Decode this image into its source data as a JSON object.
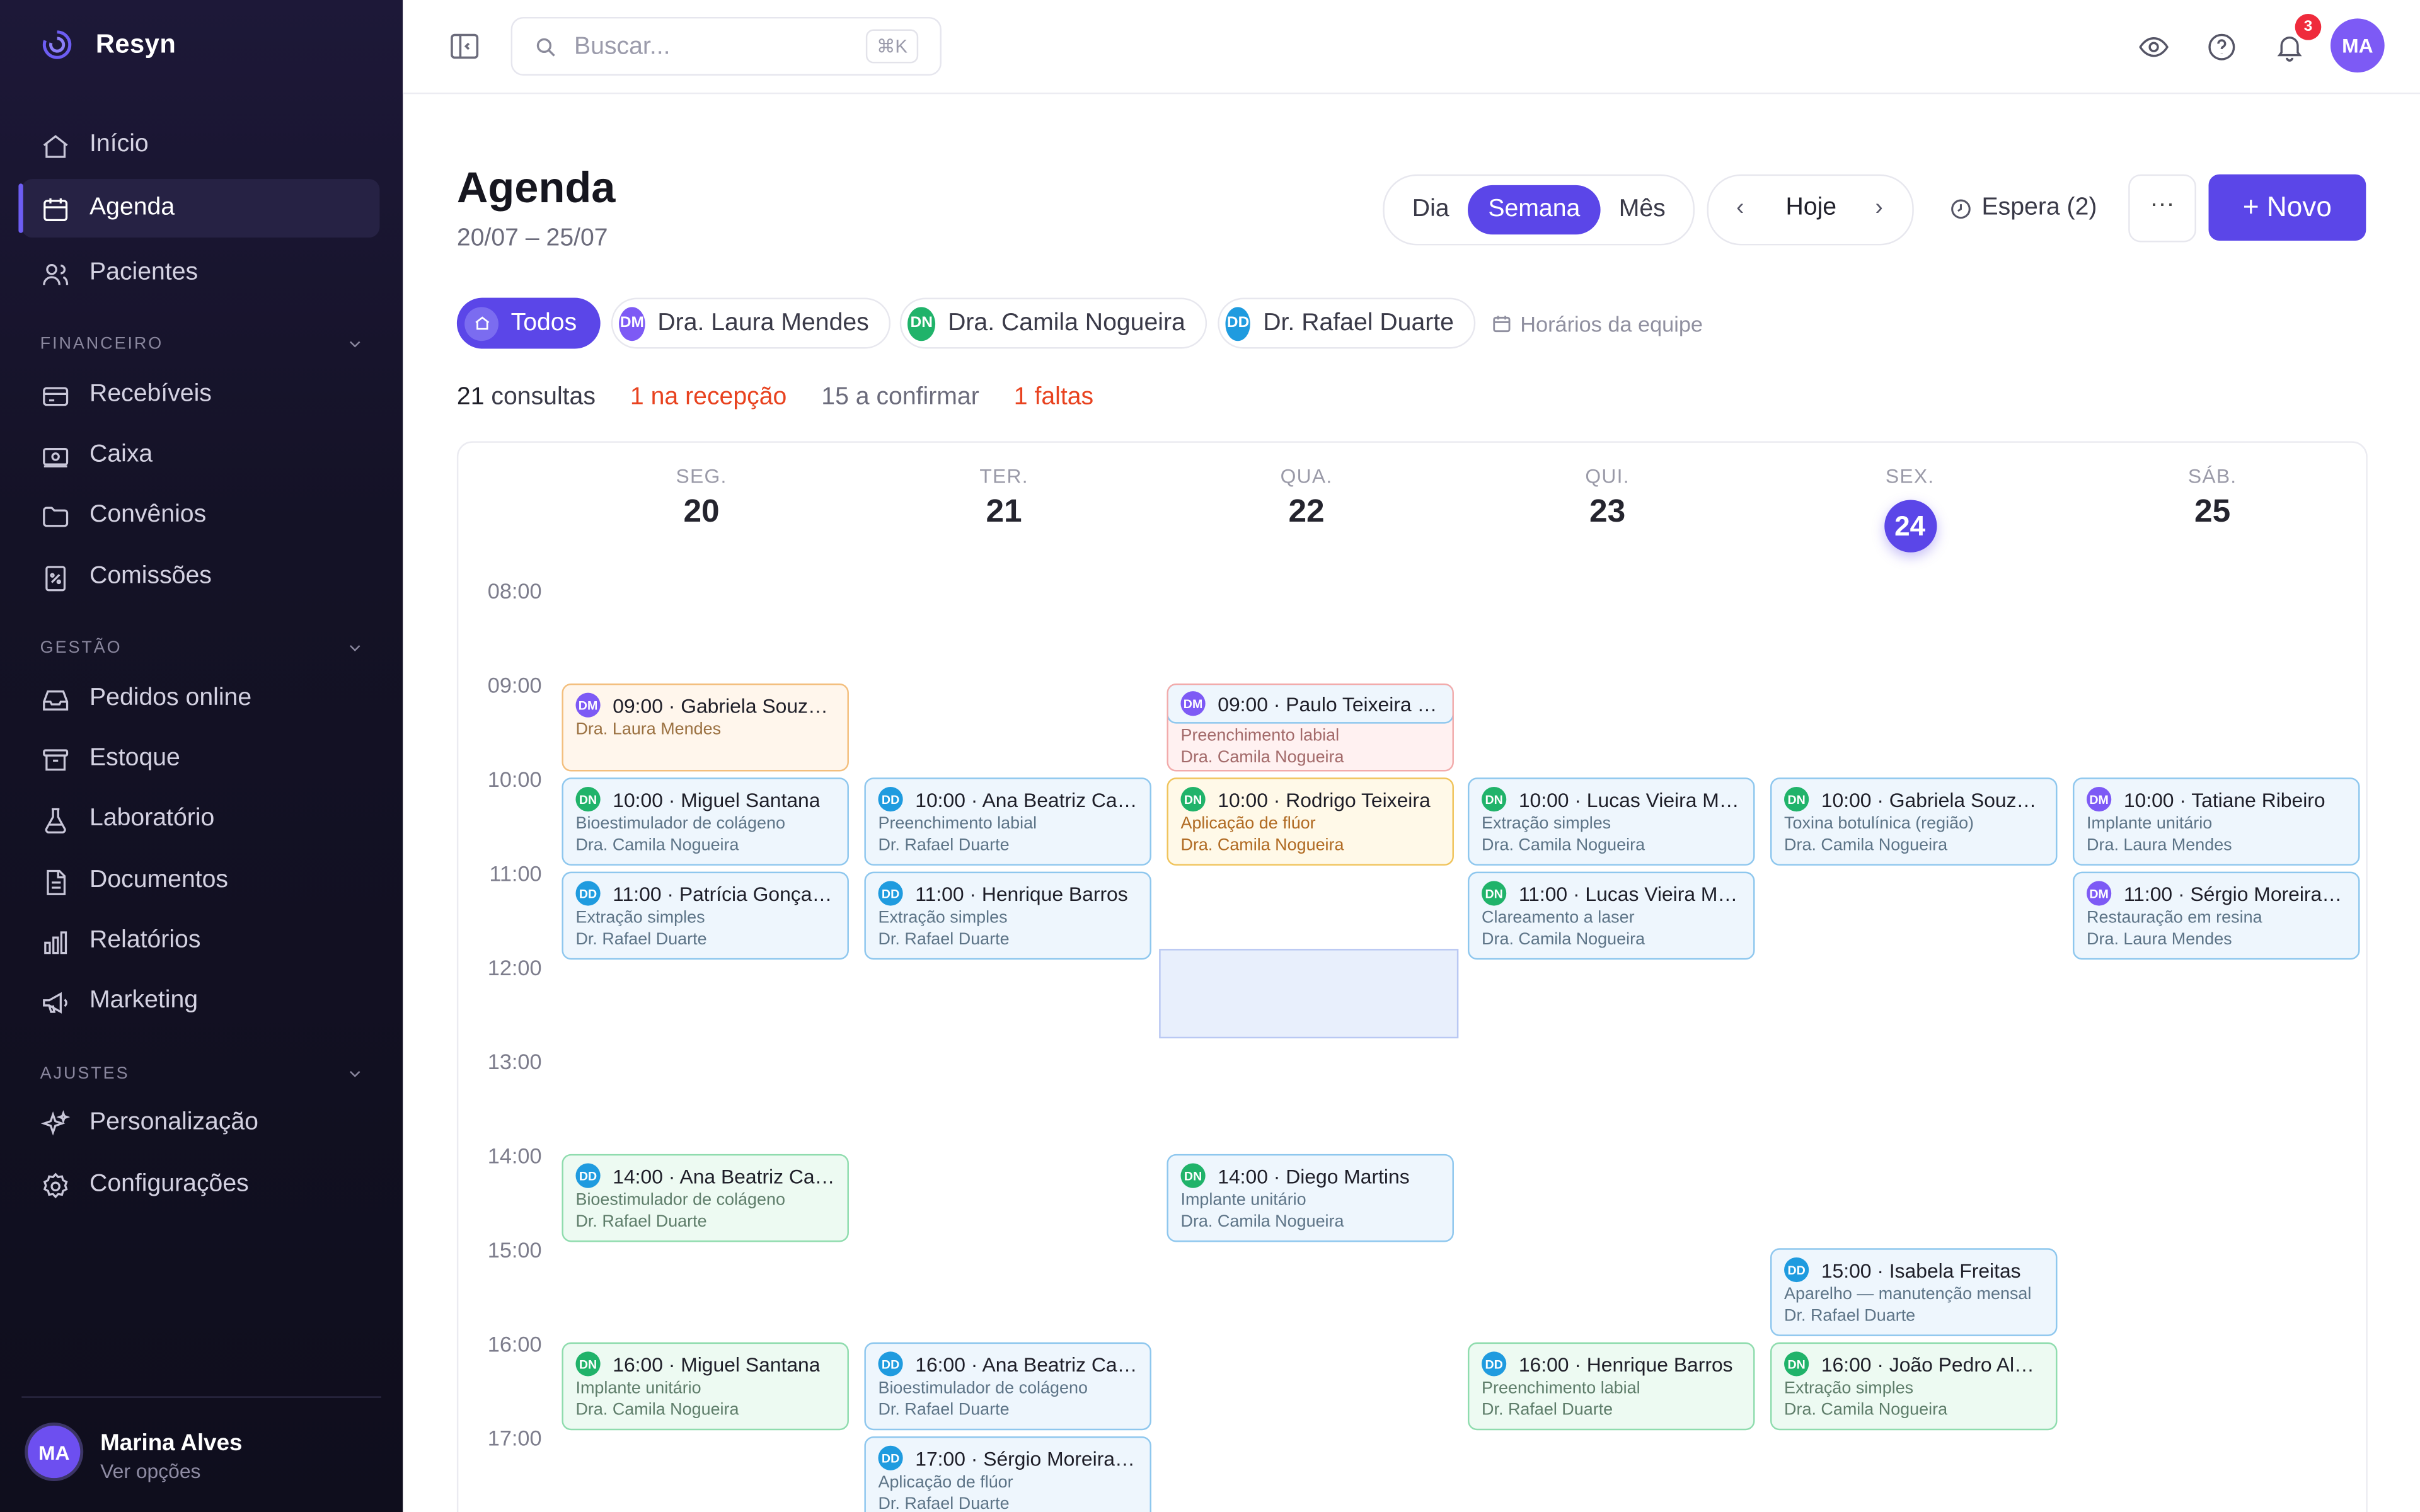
{
  "brand": {
    "name": "Resyn"
  },
  "nav": {
    "main": [
      {
        "label": "Início",
        "icon": "home-icon"
      },
      {
        "label": "Agenda",
        "icon": "calendar-icon",
        "active": true
      },
      {
        "label": "Pacientes",
        "icon": "users-icon"
      }
    ],
    "financeiro": {
      "title": "FINANCEIRO",
      "items": [
        {
          "label": "Recebíveis",
          "icon": "credit-card-icon"
        },
        {
          "label": "Caixa",
          "icon": "cash-icon"
        },
        {
          "label": "Convênios",
          "icon": "folder-icon"
        },
        {
          "label": "Comissões",
          "icon": "percent-document-icon"
        }
      ]
    },
    "gestao": {
      "title": "GESTÃO",
      "items": [
        {
          "label": "Pedidos online",
          "icon": "inbox-icon"
        },
        {
          "label": "Estoque",
          "icon": "archive-icon"
        },
        {
          "label": "Laboratório",
          "icon": "flask-icon"
        },
        {
          "label": "Documentos",
          "icon": "document-icon"
        },
        {
          "label": "Relatórios",
          "icon": "bar-chart-icon"
        },
        {
          "label": "Marketing",
          "icon": "megaphone-icon"
        }
      ]
    },
    "ajustes": {
      "title": "AJUSTES",
      "items": [
        {
          "label": "Personalização",
          "icon": "sparkles-icon"
        },
        {
          "label": "Configurações",
          "icon": "settings-icon"
        }
      ]
    }
  },
  "user": {
    "initials": "MA",
    "name": "Marina Alves",
    "sub": "Ver opções"
  },
  "topbar": {
    "search_placeholder": "Buscar...",
    "search_shortcut": "⌘K",
    "notifications": "3",
    "avatar": "MA"
  },
  "header": {
    "title": "Agenda",
    "range": "20/07 – 25/07",
    "views": [
      "Dia",
      "Semana",
      "Mês"
    ],
    "active_view": "Semana",
    "prev": "‹",
    "today": "Hoje",
    "next": "›",
    "waiting": "Espera (2)",
    "more": "···",
    "new": "+ Novo"
  },
  "filters": {
    "all": "Todos",
    "dentists": [
      {
        "initials": "DM",
        "name": "Dra. Laura Mendes",
        "color": "#7d5af5"
      },
      {
        "initials": "DN",
        "name": "Dra. Camila Nogueira",
        "color": "#20b36a"
      },
      {
        "initials": "DD",
        "name": "Dr. Rafael Duarte",
        "color": "#1f9bdf"
      }
    ],
    "team_hours": "Horários da equipe"
  },
  "stats": {
    "total": "21",
    "total_label": "consultas",
    "reception": "1",
    "reception_label": "na recepção",
    "confirm": "15",
    "confirm_label": "a confirmar",
    "missed": "1",
    "missed_label": "faltas"
  },
  "calendar": {
    "days": [
      {
        "name": "SEG.",
        "num": "20"
      },
      {
        "name": "TER.",
        "num": "21"
      },
      {
        "name": "QUA.",
        "num": "22"
      },
      {
        "name": "QUI.",
        "num": "23"
      },
      {
        "name": "SEX.",
        "num": "24",
        "today": true
      },
      {
        "name": "SÁB.",
        "num": "25"
      }
    ],
    "times": [
      "08:00",
      "09:00",
      "10:00",
      "11:00",
      "12:00",
      "13:00",
      "14:00",
      "15:00",
      "16:00",
      "17:00"
    ],
    "events": [
      {
        "day": 0,
        "hour": 9,
        "title": "09:00 · Gabriela Souza ...",
        "procedure": "",
        "dentist": "Dra. Laura Mendes",
        "initials": "DM",
        "style": "orange"
      },
      {
        "day": 2,
        "hour": 9,
        "title": "09:00 · Paulo Teixeira N...",
        "procedure": "Preenchimento labial",
        "dentist": "Dra. Camila Nogueira",
        "initials": "DM",
        "style": "red"
      },
      {
        "day": 0,
        "hour": 10,
        "title": "10:00 · Miguel Santana",
        "procedure": "Bioestimulador de colágeno",
        "dentist": "Dra. Camila Nogueira",
        "initials": "DN",
        "style": "blue"
      },
      {
        "day": 1,
        "hour": 10,
        "title": "10:00 · Ana Beatriz Car...",
        "procedure": "Preenchimento labial",
        "dentist": "Dr. Rafael Duarte",
        "initials": "DD",
        "style": "blue"
      },
      {
        "day": 2,
        "hour": 10,
        "title": "10:00 · Rodrigo Teixeira",
        "procedure": "Aplicação de flúor",
        "dentist": "Dra. Camila Nogueira",
        "initials": "DN",
        "style": "yellow"
      },
      {
        "day": 3,
        "hour": 10,
        "title": "10:00 · Lucas Vieira Ma...",
        "procedure": "Extração simples",
        "dentist": "Dra. Camila Nogueira",
        "initials": "DN",
        "style": "blue"
      },
      {
        "day": 4,
        "hour": 10,
        "title": "10:00 · Gabriela Souza ...",
        "procedure": "Toxina botulínica (região)",
        "dentist": "Dra. Camila Nogueira",
        "initials": "DN",
        "style": "blue"
      },
      {
        "day": 5,
        "hour": 10,
        "title": "10:00 · Tatiane Ribeiro",
        "procedure": "Implante unitário",
        "dentist": "Dra. Laura Mendes",
        "initials": "DM",
        "style": "blue"
      },
      {
        "day": 0,
        "hour": 11,
        "title": "11:00 · Patrícia Gonçalv...",
        "procedure": "Extração simples",
        "dentist": "Dr. Rafael Duarte",
        "initials": "DD",
        "style": "blue"
      },
      {
        "day": 1,
        "hour": 11,
        "title": "11:00 · Henrique Barros",
        "procedure": "Extração simples",
        "dentist": "Dr. Rafael Duarte",
        "initials": "DD",
        "style": "blue"
      },
      {
        "day": 3,
        "hour": 11,
        "title": "11:00 · Lucas Vieira Mac...",
        "procedure": "Clareamento a laser",
        "dentist": "Dra. Camila Nogueira",
        "initials": "DN",
        "style": "blue"
      },
      {
        "day": 5,
        "hour": 11,
        "title": "11:00 · Sérgio Moreira Li...",
        "procedure": "Restauração em resina",
        "dentist": "Dra. Laura Mendes",
        "initials": "DM",
        "style": "blue"
      },
      {
        "day": 0,
        "hour": 14,
        "title": "14:00 · Ana Beatriz Carv...",
        "procedure": "Bioestimulador de colágeno",
        "dentist": "Dr. Rafael Duarte",
        "initials": "DD",
        "style": "green"
      },
      {
        "day": 2,
        "hour": 14,
        "title": "14:00 · Diego Martins",
        "procedure": "Implante unitário",
        "dentist": "Dra. Camila Nogueira",
        "initials": "DN",
        "style": "blue"
      },
      {
        "day": 4,
        "hour": 15,
        "title": "15:00 · Isabela Freitas",
        "procedure": "Aparelho — manutenção mensal",
        "dentist": "Dr. Rafael Duarte",
        "initials": "DD",
        "style": "blue"
      },
      {
        "day": 0,
        "hour": 16,
        "title": "16:00 · Miguel Santana",
        "procedure": "Implante unitário",
        "dentist": "Dra. Camila Nogueira",
        "initials": "DN",
        "style": "green"
      },
      {
        "day": 1,
        "hour": 16,
        "title": "16:00 · Ana Beatriz Carv...",
        "procedure": "Bioestimulador de colágeno",
        "dentist": "Dr. Rafael Duarte",
        "initials": "DD",
        "style": "blue"
      },
      {
        "day": 3,
        "hour": 16,
        "title": "16:00 · Henrique Barros",
        "procedure": "Preenchimento labial",
        "dentist": "Dr. Rafael Duarte",
        "initials": "DD",
        "style": "green"
      },
      {
        "day": 4,
        "hour": 16,
        "title": "16:00 · João Pedro Alm...",
        "procedure": "Extração simples",
        "dentist": "Dra. Camila Nogueira",
        "initials": "DN",
        "style": "green"
      },
      {
        "day": 1,
        "hour": 17,
        "title": "17:00 · Sérgio Moreira L...",
        "procedure": "Aplicação de flúor",
        "dentist": "Dr. Rafael Duarte",
        "initials": "DD",
        "style": "blue"
      }
    ]
  }
}
